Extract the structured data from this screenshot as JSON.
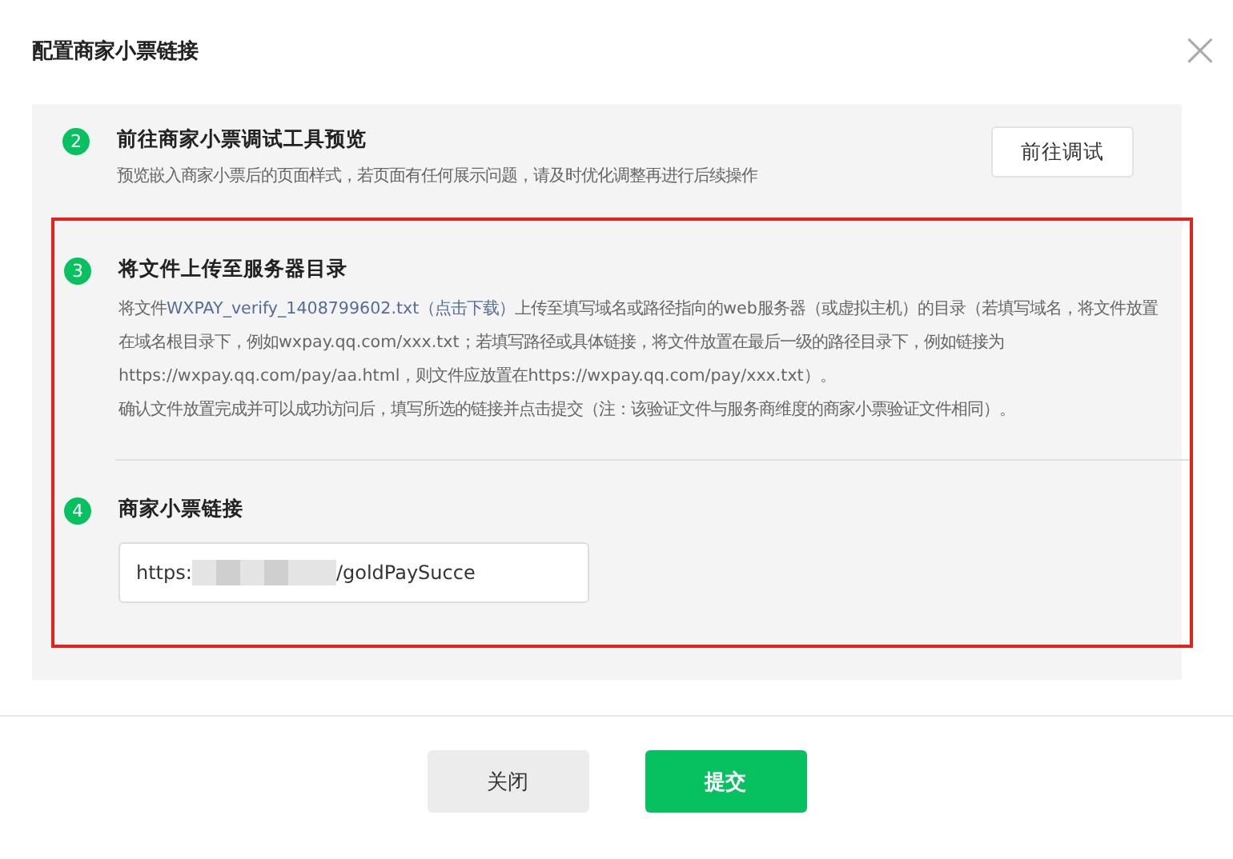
{
  "dialog": {
    "title": "配置商家小票链接",
    "close_label": "×"
  },
  "sections": [
    {
      "highlighted": false,
      "steps": [
        {
          "kind": "action",
          "number": "2",
          "title": "前往商家小票调试工具预览",
          "description": "预览嵌入商家小票后的页面样式，若页面有任何展示问题，请及时优化调整再进行后续操作",
          "button": "前往调试"
        }
      ]
    },
    {
      "highlighted": true,
      "steps": [
        {
          "kind": "upload",
          "number": "3",
          "title": "将文件上传至服务器目录",
          "text_before": "将文件",
          "link": "WXPAY_verify_1408799602.txt（点击下载）",
          "text_after": "上传至填写域名或路径指向的web服务器（或虚拟主机）的目录（若填写域名，将文件放置在域名根目录下，例如wxpay.qq.com/xxx.txt；若填写路径或具体链接，将文件放置在最后一级的路径目录下，例如链接为https://wxpay.qq.com/pay/aa.html，则文件应放置在https://wxpay.qq.com/pay/xxx.txt）。",
          "note": "确认文件放置完成并可以成功访问后，填写所选的链接并点击提交（注：该验证文件与服务商维度的商家小票验证文件相同）。"
        },
        {
          "kind": "input",
          "number": "4",
          "title": "商家小票链接",
          "value_start": "https:",
          "value_end": "/goldPaySucce",
          "redacted": true
        }
      ]
    }
  ],
  "buttons": [
    {
      "label": "关闭",
      "primary": false
    },
    {
      "label": "提交",
      "primary": true
    }
  ]
}
